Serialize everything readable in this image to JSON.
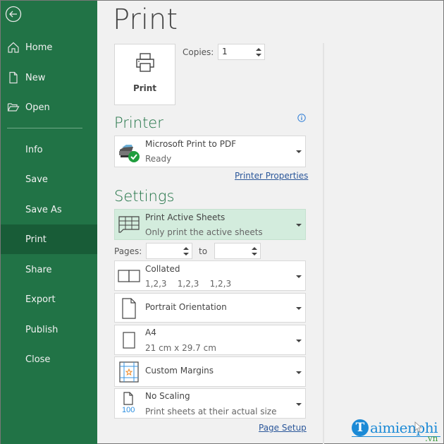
{
  "sidebar": {
    "back_label": "Back",
    "top_items": [
      {
        "label": "Home",
        "icon": "home-icon"
      },
      {
        "label": "New",
        "icon": "new-file-icon"
      },
      {
        "label": "Open",
        "icon": "folder-open-icon"
      }
    ],
    "items": [
      {
        "label": "Info"
      },
      {
        "label": "Save"
      },
      {
        "label": "Save As"
      },
      {
        "label": "Print",
        "active": true
      },
      {
        "label": "Share"
      },
      {
        "label": "Export"
      },
      {
        "label": "Publish"
      },
      {
        "label": "Close"
      }
    ]
  },
  "main": {
    "title": "Print",
    "print_button": "Print",
    "copies_label": "Copies:",
    "copies_value": "1",
    "printer": {
      "heading": "Printer",
      "name": "Microsoft Print to PDF",
      "status": "Ready",
      "properties_link": "Printer Properties"
    },
    "settings": {
      "heading": "Settings",
      "what_to_print": {
        "title": "Print Active Sheets",
        "subtitle": "Only print the active sheets"
      },
      "pages_label": "Pages:",
      "pages_from": "",
      "to_label": "to",
      "pages_to": "",
      "collation": {
        "title": "Collated",
        "subtitle": "1,2,3    1,2,3    1,2,3"
      },
      "orientation": {
        "title": "Portrait Orientation"
      },
      "paper": {
        "title": "A4",
        "subtitle": "21 cm x 29.7 cm"
      },
      "margins": {
        "title": "Custom Margins"
      },
      "scaling": {
        "title": "No Scaling",
        "subtitle": "Print sheets at their actual size",
        "icon_text": "100"
      },
      "page_setup_link": "Page Setup"
    }
  },
  "watermark": {
    "letter": "T",
    "text": "aimienphi",
    "suffix": ".vn"
  },
  "colors": {
    "accent": "#217346",
    "accent_dark": "#185c37",
    "selected_bg": "#d3ecdd",
    "link": "#2b579a"
  }
}
